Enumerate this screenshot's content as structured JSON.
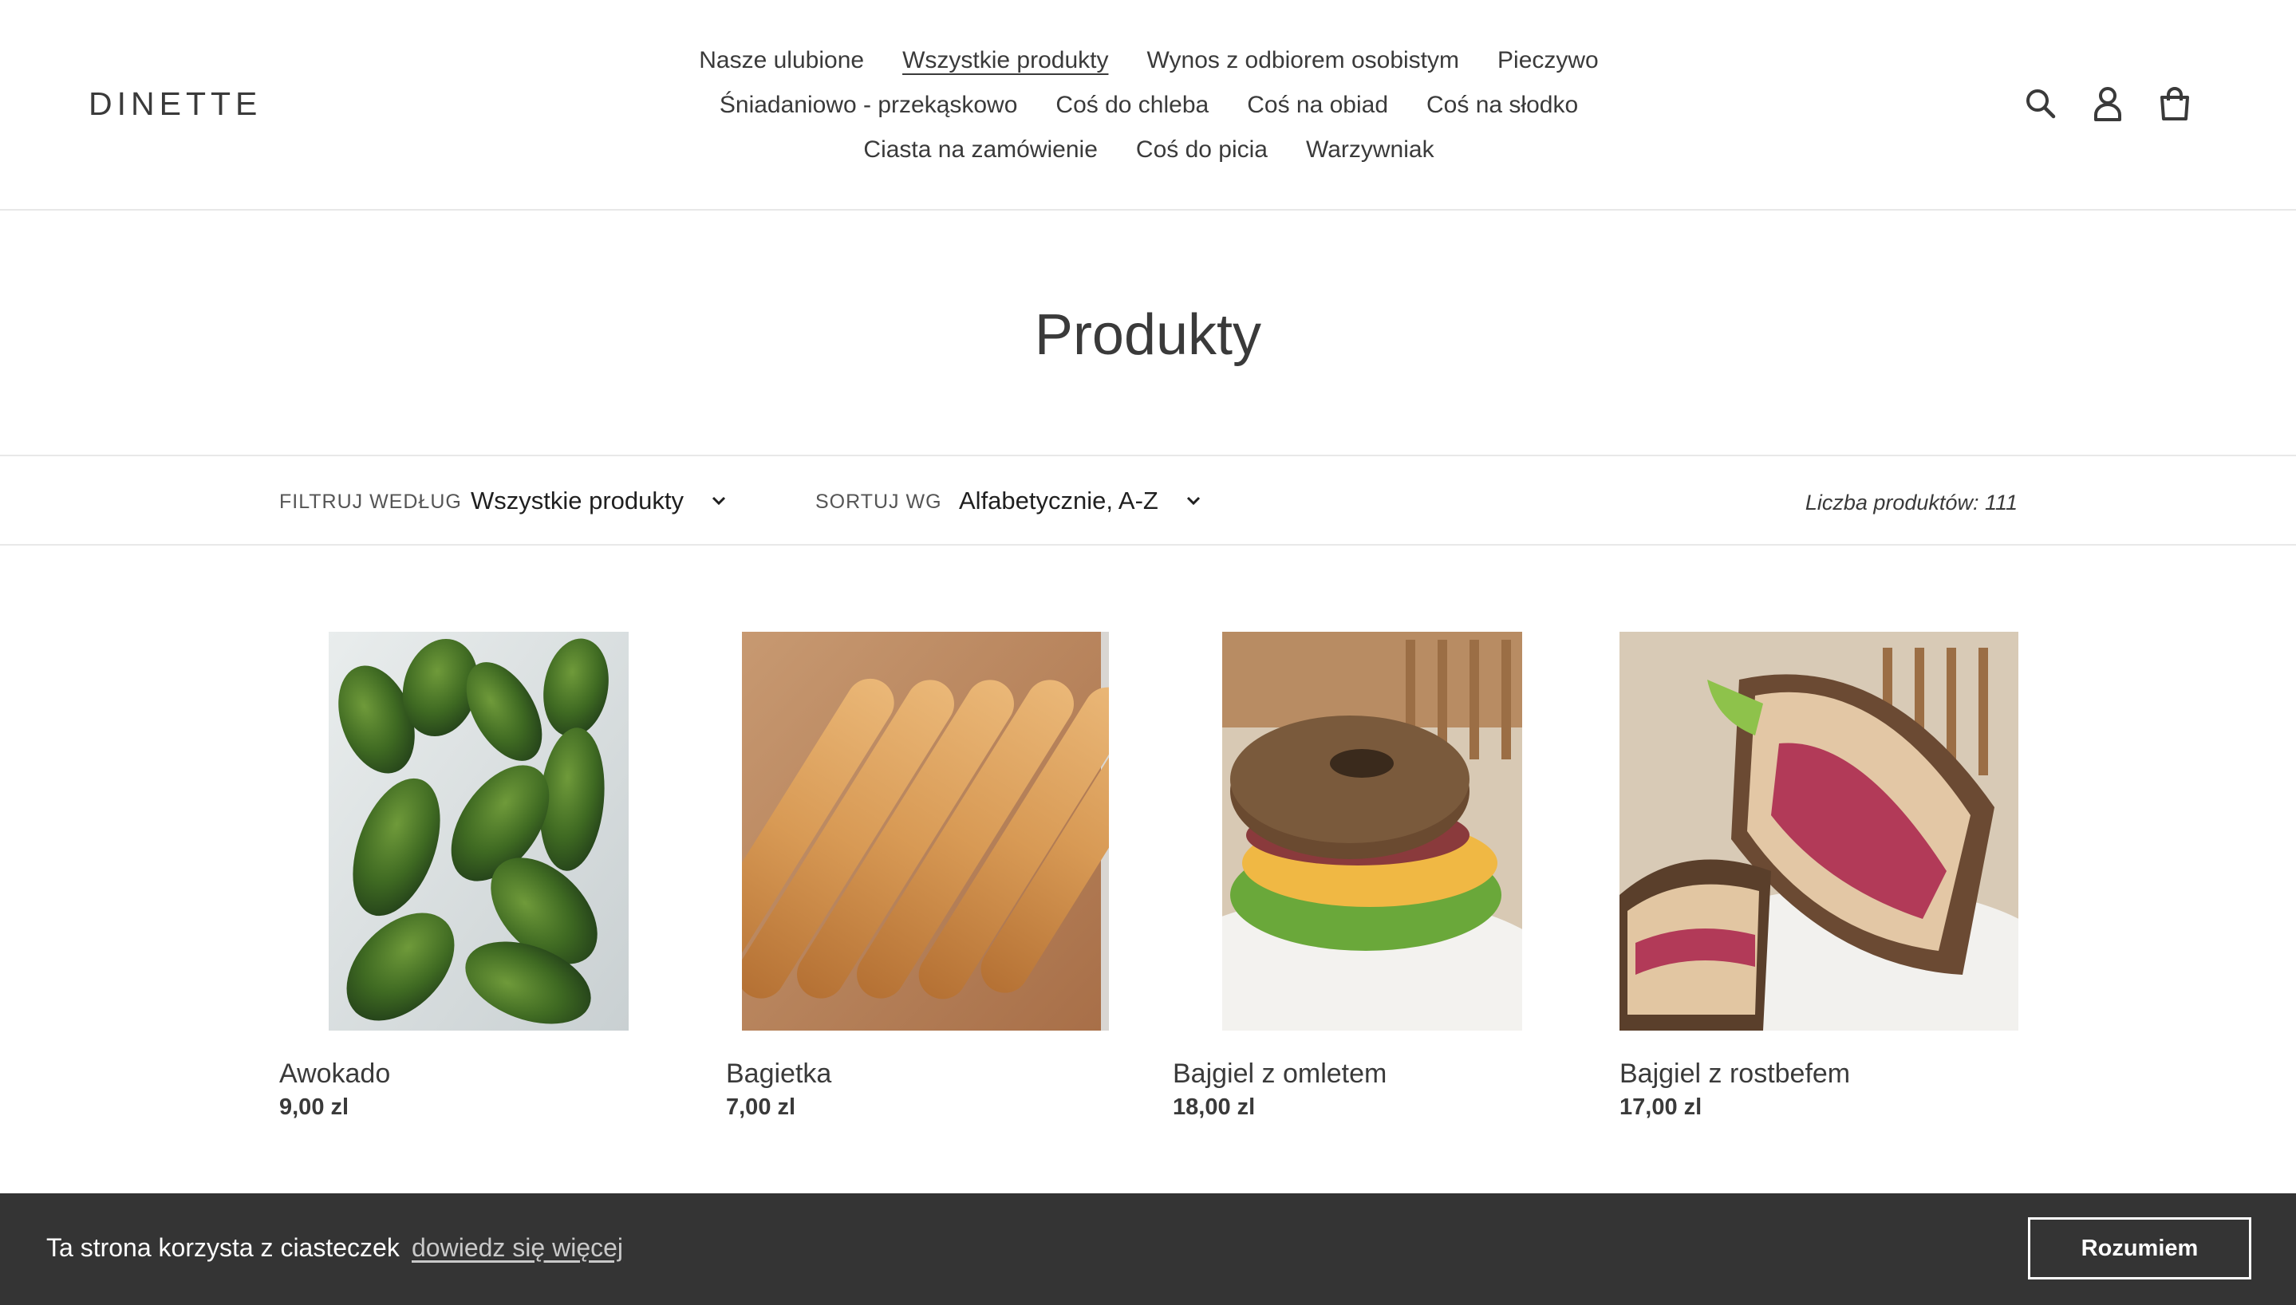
{
  "brand": {
    "logo_text": "DINETTE"
  },
  "nav": {
    "rows": [
      [
        {
          "label": "Nasze ulubione"
        },
        {
          "label": "Wszystkie produkty",
          "active": true
        },
        {
          "label": "Wynos z odbiorem osobistym"
        },
        {
          "label": "Pieczywo"
        }
      ],
      [
        {
          "label": "Śniadaniowo - przekąskowo"
        },
        {
          "label": "Coś do chleba"
        },
        {
          "label": "Coś na obiad"
        },
        {
          "label": "Coś na słodko"
        }
      ],
      [
        {
          "label": "Ciasta na zamówienie"
        },
        {
          "label": "Coś do picia"
        },
        {
          "label": "Warzywniak"
        }
      ]
    ]
  },
  "header_icons": [
    "search-icon",
    "account-icon",
    "cart-icon"
  ],
  "page": {
    "title": "Produkty"
  },
  "filters": {
    "filter_label": "FILTRUJ WEDŁUG",
    "filter_value": "Wszystkie produkty",
    "sort_label": "SORTUJ WG",
    "sort_value": "Alfabetycznie, A-Z",
    "count_text": "Liczba produktów: 111"
  },
  "products": [
    {
      "name": "Awokado",
      "price": "9,00 zl",
      "image": "avocados-photo"
    },
    {
      "name": "Bagietka",
      "price": "7,00 zl",
      "image": "baguettes-photo"
    },
    {
      "name": "Bajgiel z omletem",
      "price": "18,00 zl",
      "image": "bagel-omelette-photo"
    },
    {
      "name": "Bajgiel z rostbefem",
      "price": "17,00 zl",
      "image": "bagel-roastbeef-photo"
    }
  ],
  "cookie": {
    "message": "Ta strona korzysta z ciasteczek",
    "link": "dowiedz się więcej",
    "button": "Rozumiem"
  },
  "colors": {
    "text": "#3a3a3a",
    "cookie_bg": "#343434",
    "divider": "#e8e8e8"
  }
}
